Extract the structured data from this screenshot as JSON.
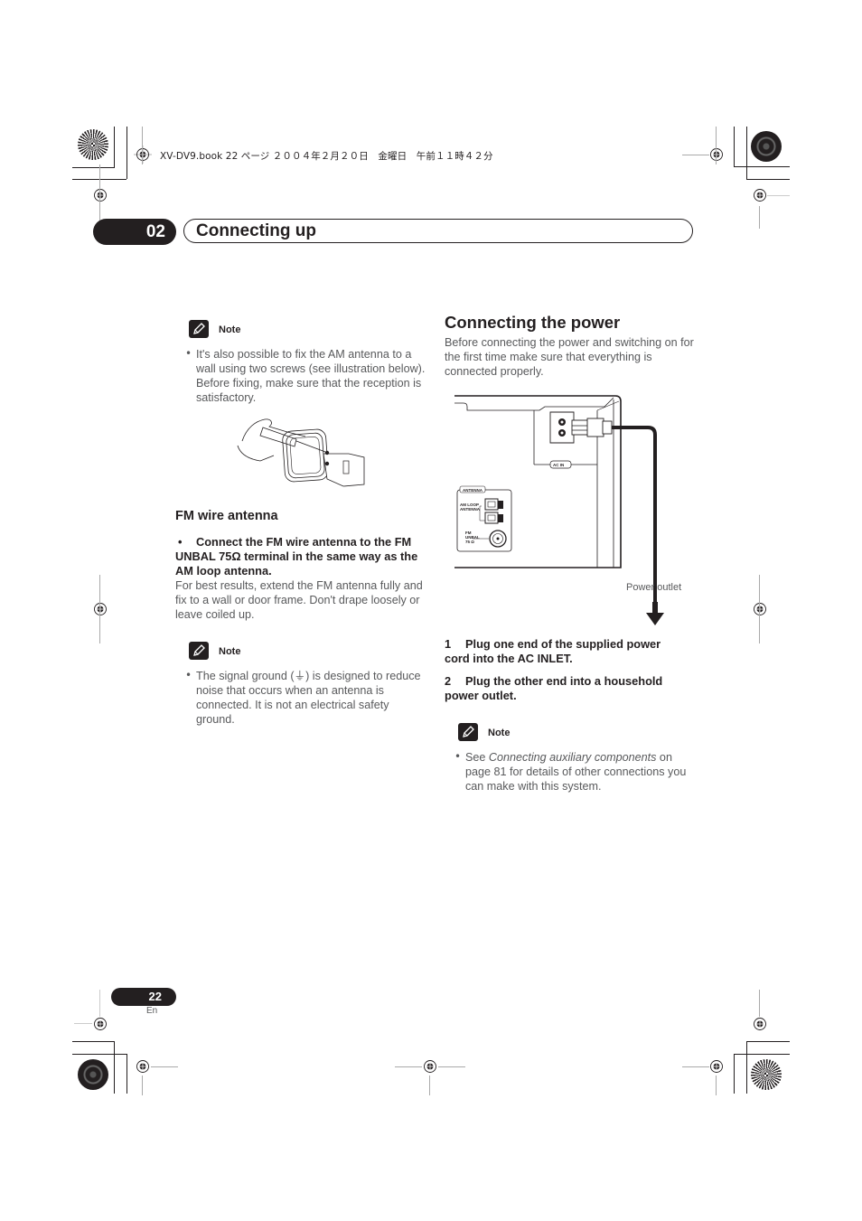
{
  "print_header": "XV-DV9.book  22 ページ  ２００４年２月２０日　金曜日　午前１１時４２分",
  "chapter": {
    "number": "02",
    "title": "Connecting up"
  },
  "left_column": {
    "note1": {
      "label": "Note",
      "bullet": "It's also possible to fix the AM antenna to a wall using two screws (see illustration below). Before fixing, make sure that the reception is satisfactory.",
      "illustration": "am-loop-antenna-screw-mounting"
    },
    "fm_section": {
      "heading": "FM wire antenna",
      "bullet_symbol": "•",
      "instruction": "Connect the FM wire antenna to the FM UNBAL 75Ω terminal in the same way as the AM loop antenna.",
      "body": "For best results, extend the FM antenna fully and fix to a wall or door frame. Don't drape loosely or leave coiled up."
    },
    "note2": {
      "label": "Note",
      "bullet_before": "The signal ground (",
      "ground_symbol": "⏚",
      "bullet_after": ") is designed to reduce noise that occurs when an antenna is connected. It is not an electrical safety ground."
    }
  },
  "right_column": {
    "heading": "Connecting the power",
    "intro": "Before connecting the power and switching on for the first time make sure that everything is connected properly.",
    "diagram": {
      "ac_in_label": "AC IN",
      "antenna_label": "ANTENNA",
      "am_loop_label_1": "AM LOOP",
      "am_loop_label_2": "ANTENNA",
      "fm_label_1": "FM",
      "fm_label_2": "UNBAL",
      "fm_label_3": "75 Ω",
      "power_outlet_label": "Power outlet"
    },
    "steps": [
      {
        "number": "1",
        "text_line1": "Plug one end of the supplied power",
        "text_line2": "cord into the AC INLET."
      },
      {
        "number": "2",
        "text_line1": "Plug the other end into a household",
        "text_line2": "power outlet."
      }
    ],
    "note3": {
      "label": "Note",
      "see": "See ",
      "link_italic": "Connecting auxiliary components",
      "rest_line1": " on",
      "rest": "page 81 for details of other connections you can make with this system."
    }
  },
  "footer": {
    "page_number": "22",
    "language": "En"
  }
}
